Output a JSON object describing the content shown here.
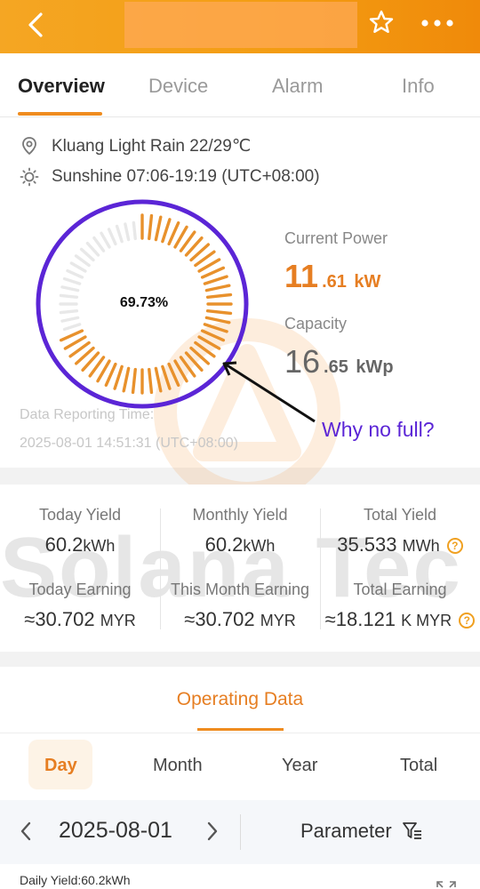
{
  "header": {
    "back_icon": "chevron-left-icon",
    "favorite_icon": "star-icon",
    "more_icon": "more-dots-icon"
  },
  "tabs": [
    {
      "label": "Overview",
      "active": true
    },
    {
      "label": "Device",
      "active": false
    },
    {
      "label": "Alarm",
      "active": false
    },
    {
      "label": "Info",
      "active": false
    }
  ],
  "location": {
    "icon": "location-pin-icon",
    "text": "Kluang Light Rain 22/29℃"
  },
  "sun": {
    "icon": "sun-icon",
    "text": "Sunshine 07:06-19:19 (UTC+08:00)"
  },
  "gauge": {
    "percent_text": "69.73%",
    "fraction": 0.6973,
    "active_color": "#e8912c",
    "inactive_color": "#e8e8e8",
    "ring_color": "#5b25d6"
  },
  "current_power": {
    "label": "Current Power",
    "integer": "11",
    "decimal": ".61",
    "unit": "kW"
  },
  "capacity": {
    "label": "Capacity",
    "integer": "16",
    "decimal": ".65",
    "unit": "kWp"
  },
  "report": {
    "label": "Data Reporting Time:",
    "time": "2025-08-01 14:51:31 (UTC+08:00)"
  },
  "annotation": {
    "text": "Why no full?"
  },
  "watermark": {
    "text": "Solana Tec"
  },
  "stats": {
    "today_yield": {
      "label": "Today Yield",
      "value": "60.2",
      "unit": "kWh"
    },
    "monthly_yield": {
      "label": "Monthly Yield",
      "value": "60.2",
      "unit": "kWh"
    },
    "total_yield": {
      "label": "Total Yield",
      "value": "35.533",
      "unit": "MWh"
    },
    "today_earning": {
      "label": "Today Earning",
      "value": "≈30.702",
      "unit": "MYR"
    },
    "month_earning": {
      "label": "This Month Earning",
      "value": "≈30.702",
      "unit": "MYR"
    },
    "total_earning": {
      "label": "Total Earning",
      "value": "≈18.121",
      "unit": "K MYR"
    },
    "help_glyph": "?"
  },
  "operating": {
    "title": "Operating Data",
    "periods": [
      {
        "label": "Day",
        "active": true
      },
      {
        "label": "Month",
        "active": false
      },
      {
        "label": "Year",
        "active": false
      },
      {
        "label": "Total",
        "active": false
      }
    ],
    "date": "2025-08-01",
    "parameter_label": "Parameter",
    "daily_yield": "Daily Yield:60.2kWh"
  },
  "colors": {
    "accent": "#e67e22",
    "annotation": "#5b25d6",
    "header": "#f39c12"
  }
}
